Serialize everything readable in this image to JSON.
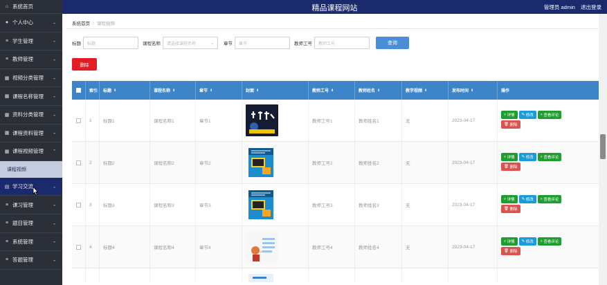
{
  "app": {
    "title": "精品课程网站"
  },
  "header": {
    "user_label": "管理员 admin",
    "logout_label": "退出登录"
  },
  "sidebar": {
    "items": [
      {
        "label": "系统首页",
        "icon": "home-icon"
      },
      {
        "label": "个人中心",
        "icon": "user-icon"
      },
      {
        "label": "学生管理",
        "icon": "list-icon"
      },
      {
        "label": "教师管理",
        "icon": "list-icon"
      },
      {
        "label": "视频分类管理",
        "icon": "grid-icon"
      },
      {
        "label": "课程名称管理",
        "icon": "grid-icon"
      },
      {
        "label": "资料分类管理",
        "icon": "grid-icon"
      },
      {
        "label": "课程资料管理",
        "icon": "grid-icon"
      },
      {
        "label": "课程视频管理",
        "icon": "grid-icon"
      },
      {
        "label": "学习交流",
        "icon": "chat-icon"
      },
      {
        "label": "课习管理",
        "icon": "list-icon"
      },
      {
        "label": "题目管理",
        "icon": "list-icon"
      },
      {
        "label": "系统管理",
        "icon": "list-icon"
      },
      {
        "label": "答题管理",
        "icon": "list-icon"
      }
    ],
    "submenu_label": "课程视频"
  },
  "breadcrumb": {
    "home": "系统首页",
    "current": "课程视频"
  },
  "search": {
    "title_label": "标题",
    "title_placeholder": "标题",
    "course_label": "课程名称",
    "course_placeholder": "请选择课程名称",
    "chapter_label": "章节",
    "chapter_placeholder": "章节",
    "teacher_label": "教师工号",
    "teacher_placeholder": "教师工号",
    "query_label": "查询"
  },
  "delete_label": "删除",
  "table": {
    "headers": [
      "索引",
      "标题",
      "课程名称",
      "章节",
      "封面",
      "教师工号",
      "教师姓名",
      "教学视频",
      "发布时间",
      "操作"
    ],
    "rows": [
      {
        "index": "1",
        "title": "标题1",
        "course": "课程名称1",
        "chapter": "章节1",
        "teacher_id": "教师工号1",
        "teacher_name": "教师姓名1",
        "video": "无",
        "date": "2023-04-17",
        "cover": "kids-coding-cover"
      },
      {
        "index": "2",
        "title": "标题2",
        "course": "课程名称2",
        "chapter": "章节2",
        "teacher_id": "教师工号2",
        "teacher_name": "教师姓名2",
        "video": "无",
        "date": "2023-04-17",
        "cover": "book-cover"
      },
      {
        "index": "3",
        "title": "标题3",
        "course": "课程名称3",
        "chapter": "章节3",
        "teacher_id": "教师工号3",
        "teacher_name": "教师姓名3",
        "video": "无",
        "date": "2023-04-17",
        "cover": "book-cover"
      },
      {
        "index": "4",
        "title": "标题4",
        "course": "课程名称4",
        "chapter": "章节4",
        "teacher_id": "教师工号4",
        "teacher_name": "教师姓名4",
        "video": "无",
        "date": "2023-04-17",
        "cover": "diagram-cover"
      }
    ],
    "actions": {
      "detail": "详情",
      "edit": "修改",
      "review": "查看评论",
      "delete": "删除"
    }
  },
  "colors": {
    "header": "#1a2a6c",
    "sidebar": "#2b2f38",
    "table_header": "#3d84c9",
    "delete": "#e51c23",
    "green": "#1f9d2f",
    "blue": "#1a9cd8"
  }
}
